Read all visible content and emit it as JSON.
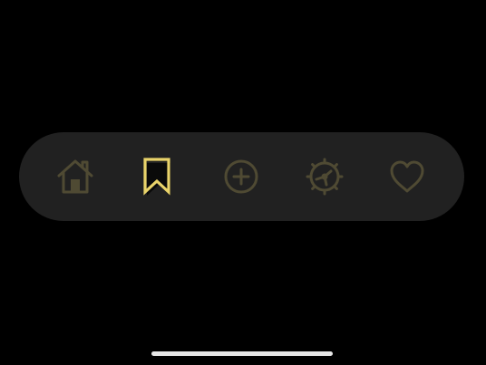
{
  "tabbar": {
    "items": [
      {
        "id": "home",
        "icon": "home-icon",
        "active": false
      },
      {
        "id": "bookmark",
        "icon": "bookmark-icon",
        "active": true
      },
      {
        "id": "add",
        "icon": "plus-circle-icon",
        "active": false
      },
      {
        "id": "settings",
        "icon": "gear-icon",
        "active": false
      },
      {
        "id": "favorite",
        "icon": "heart-icon",
        "active": false
      }
    ]
  },
  "colors": {
    "background": "#000000",
    "tabbar_background": "#212121",
    "inactive_icon": "#4f4a33",
    "active_icon": "#e9d36a",
    "home_indicator": "#e6e6e6"
  }
}
